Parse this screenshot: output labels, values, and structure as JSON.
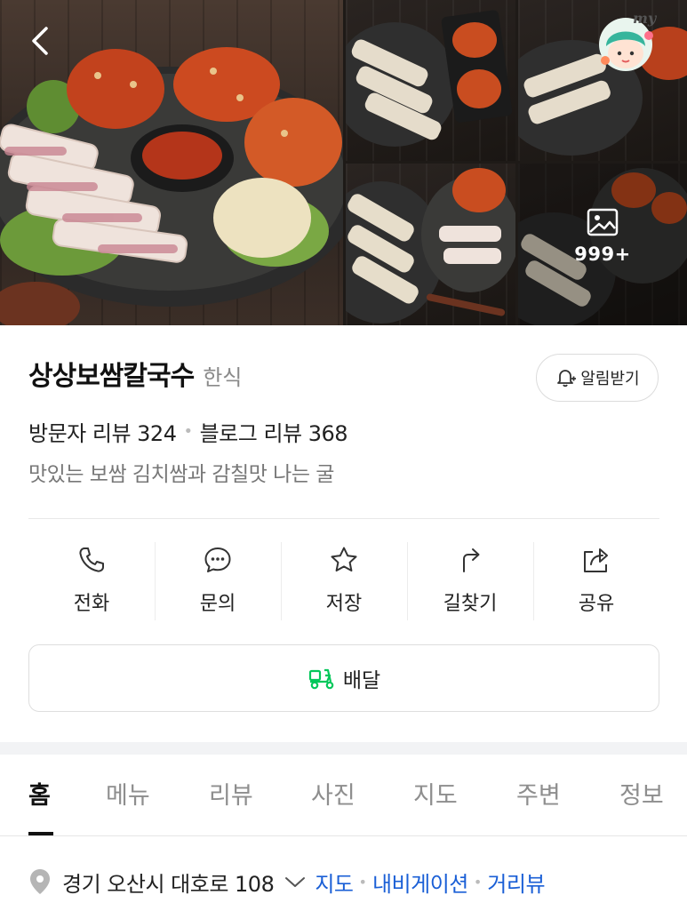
{
  "header": {
    "photo_count": "999+"
  },
  "place": {
    "name": "상상보쌈칼국수",
    "category": "한식",
    "alarm_label": "알림받기",
    "visitor_review": "방문자 리뷰 324",
    "blog_review": "블로그 리뷰 368",
    "description": "맛있는 보쌈 김치쌈과 감칠맛 나는 굴"
  },
  "actions": [
    {
      "label": "전화",
      "icon": "phone-icon"
    },
    {
      "label": "문의",
      "icon": "chat-icon"
    },
    {
      "label": "저장",
      "icon": "star-icon"
    },
    {
      "label": "길찾기",
      "icon": "directions-icon"
    },
    {
      "label": "공유",
      "icon": "share-icon"
    }
  ],
  "delivery": {
    "label": "배달",
    "icon": "delivery-scooter-icon",
    "accent": "#03c75a"
  },
  "tabs": [
    {
      "label": "홈",
      "active": true
    },
    {
      "label": "메뉴"
    },
    {
      "label": "리뷰"
    },
    {
      "label": "사진"
    },
    {
      "label": "지도"
    },
    {
      "label": "주변"
    },
    {
      "label": "정보"
    }
  ],
  "address": {
    "text": "경기 오산시 대호로 108",
    "links": [
      "지도",
      "내비게이션",
      "거리뷰"
    ]
  },
  "colors": {
    "link": "#1a5fd6",
    "text": "#111111",
    "muted": "#8a8a8a"
  }
}
